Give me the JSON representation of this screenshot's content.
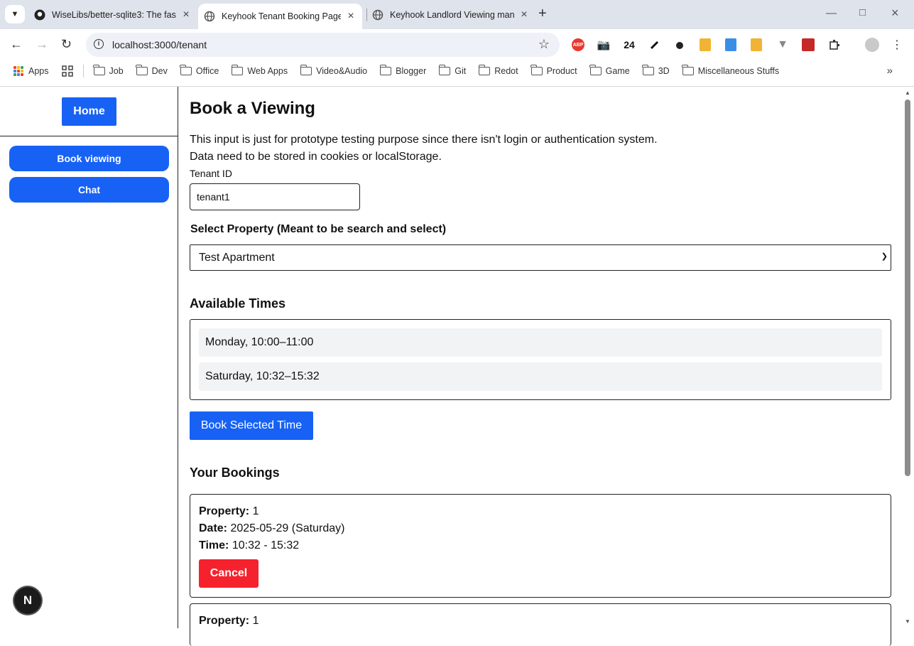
{
  "browser": {
    "tabs": [
      {
        "title": "WiseLibs/better-sqlite3: The fas",
        "active": false
      },
      {
        "title": "Keyhook Tenant Booking Page",
        "active": true
      },
      {
        "title": "Keyhook Landlord Viewing man",
        "active": false
      }
    ],
    "url": "localhost:3000/tenant",
    "extension_badge": "24",
    "bookmarks": [
      "Apps",
      "Job",
      "Dev",
      "Office",
      "Web Apps",
      "Video&Audio",
      "Blogger",
      "Git",
      "Redot",
      "Product",
      "Game",
      "3D",
      "Miscellaneous Stuffs"
    ]
  },
  "sidebar": {
    "home_label": "Home",
    "items": [
      {
        "label": "Book viewing"
      },
      {
        "label": "Chat"
      }
    ],
    "badge_letter": "N"
  },
  "main": {
    "title": "Book a Viewing",
    "note_line1": "This input is just for prototype testing purpose since there isn't login or authentication system.",
    "note_line2": "Data need to be stored in cookies or localStorage.",
    "tenant_label": "Tenant ID",
    "tenant_value": "tenant1",
    "property_label": "Select Property (Meant to be search and select)",
    "property_selected": "Test Apartment",
    "available_heading": "Available Times",
    "time_slots": [
      {
        "label": "Monday, 10:00–11:00"
      },
      {
        "label": "Saturday, 10:32–15:32"
      }
    ],
    "book_button": "Book Selected Time",
    "bookings_heading": "Your Bookings",
    "booking_labels": {
      "property": "Property:",
      "date": "Date:",
      "time": "Time:"
    },
    "bookings": [
      {
        "property": "1",
        "date": "2025-05-29 (Saturday)",
        "time": "10:32 - 15:32",
        "cancel": "Cancel"
      },
      {
        "property": "1"
      }
    ]
  },
  "colors": {
    "primary": "#1762f5",
    "danger": "#f5222d",
    "slot_bg": "#f2f3f5"
  }
}
